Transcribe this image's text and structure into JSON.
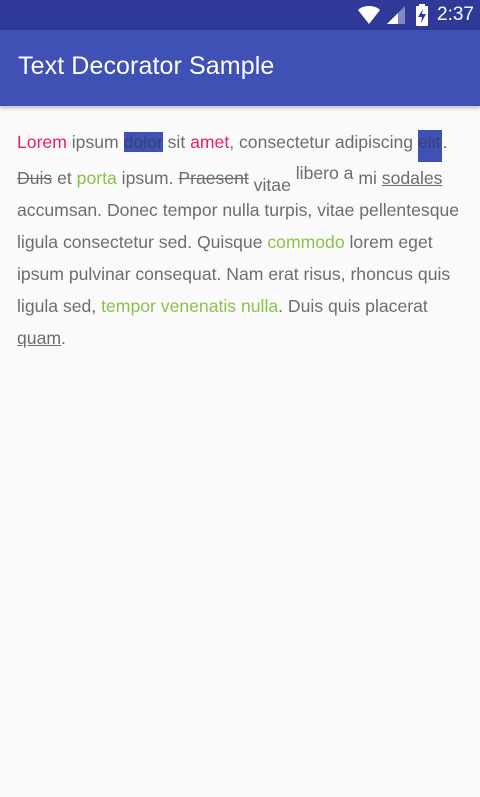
{
  "status_bar": {
    "time": "2:37"
  },
  "app_bar": {
    "title": "Text Decorator Sample"
  },
  "content": {
    "segments": [
      {
        "text": "Lorem",
        "style": "pink"
      },
      {
        "text": " ipsum ",
        "style": "plain"
      },
      {
        "text": "dolor",
        "style": "highlight"
      },
      {
        "text": " sit ",
        "style": "plain"
      },
      {
        "text": "amet",
        "style": "pink"
      },
      {
        "text": ", consectetur adipiscing ",
        "style": "plain"
      },
      {
        "text": "elit",
        "style": "highlight-tall"
      },
      {
        "text": ". ",
        "style": "plain"
      },
      {
        "text": "Duis",
        "style": "strike"
      },
      {
        "text": " et ",
        "style": "plain"
      },
      {
        "text": "porta",
        "style": "lime"
      },
      {
        "text": " ipsum. ",
        "style": "plain"
      },
      {
        "text": "Praesent",
        "style": "strike"
      },
      {
        "text": " vitae",
        "style": "subscript"
      },
      {
        "text": " libero a",
        "style": "superscript"
      },
      {
        "text": " mi ",
        "style": "plain"
      },
      {
        "text": "sodales",
        "style": "underline"
      },
      {
        "text": " accumsan. Donec tempor nulla turpis, vitae pellentesque ligula consectetur sed. Quisque ",
        "style": "plain"
      },
      {
        "text": "commodo",
        "style": "lime"
      },
      {
        "text": " lorem eget ipsum pulvinar consequat. Nam erat risus, rhoncus quis ligula sed, ",
        "style": "plain"
      },
      {
        "text": "tempor venenatis nulla",
        "style": "lime"
      },
      {
        "text": ". Duis quis placerat ",
        "style": "plain"
      },
      {
        "text": "quam",
        "style": "underline"
      },
      {
        "text": ".",
        "style": "plain"
      }
    ]
  },
  "colors": {
    "primary": "#3f51b5",
    "primary_dark": "#2f3a98",
    "pink_accent": "#e91e63",
    "lime_accent": "#8bc34a",
    "body_text": "#6d6d6d"
  },
  "icons": [
    "wifi-icon",
    "cell-signal-icon",
    "battery-charging-icon"
  ]
}
